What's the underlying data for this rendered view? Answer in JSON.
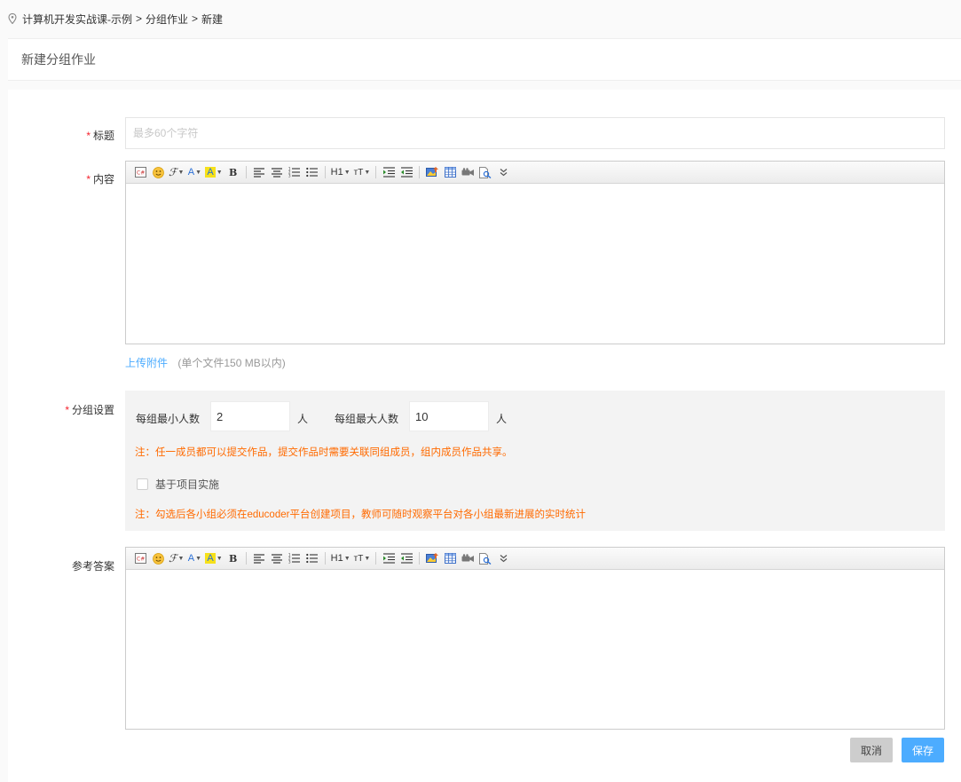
{
  "breadcrumb": {
    "items": [
      "计算机开发实战课-示例",
      "分组作业",
      "新建"
    ],
    "separator": ">"
  },
  "page_title": "新建分组作业",
  "form": {
    "title": {
      "required_mark": "*",
      "label": "标题",
      "placeholder": "最多60个字符",
      "value": ""
    },
    "content": {
      "required_mark": "*",
      "label": "内容"
    },
    "upload": {
      "link": "上传附件",
      "hint": "(单个文件150 MB以内)"
    },
    "group_settings": {
      "required_mark": "*",
      "label": "分组设置",
      "min_label": "每组最小人数",
      "min_value": "2",
      "max_label": "每组最大人数",
      "max_value": "10",
      "unit": "人",
      "note1": "注：任一成员都可以提交作品，提交作品时需要关联同组成员，组内成员作品共享。",
      "checkbox_label": "基于项目实施",
      "checkbox_checked": false,
      "note2": "注：勾选后各小组必须在educoder平台创建项目，教师可随时观察平台对各小组最新进展的实时统计"
    },
    "reference": {
      "label": "参考答案"
    },
    "buttons": {
      "cancel": "取消",
      "save": "保存"
    }
  },
  "toolbar": {
    "h1": "H1",
    "font_size": "тT",
    "bold": "B",
    "font_family": "ℱ",
    "font_color": "A",
    "bg_color": "A"
  },
  "colors": {
    "accent": "#4cacff",
    "required": "#f5222d",
    "note": "#ff6a00"
  }
}
